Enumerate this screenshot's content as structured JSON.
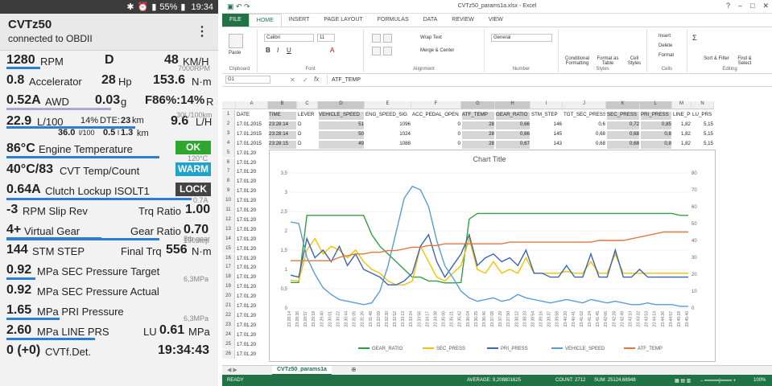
{
  "phone": {
    "status_bar": {
      "battery": "55%",
      "time": "19:34"
    },
    "app_title": "CVTz50",
    "app_subtitle": "connected to OBDII",
    "rows": {
      "r1": {
        "a": "1280",
        "b": "RPM",
        "c": "D",
        "d": "48",
        "e": "KM/H",
        "g": "7000RPM"
      },
      "r2": {
        "a": "0.8",
        "b": "Accelerator",
        "c": "28",
        "d": "Hp",
        "e": "153.6",
        "f": "N·m"
      },
      "r3": {
        "a": "0.52A",
        "b": "AWD",
        "c": "0.03",
        "d": "g",
        "e": "F86%:14%",
        "f": "R"
      },
      "r4": {
        "a": "22.9",
        "b": "L/100",
        "c": "14%",
        "d": "DTE:",
        "e": "23",
        "f": "km",
        "g": "9.6",
        "h": "L/H",
        "i": "30L/100km"
      },
      "r4b": {
        "a": "36.0",
        "b": "l/100",
        "c": "0.5",
        "d": "l",
        "e": "1.3",
        "f": "km"
      },
      "r5": {
        "a": "86°C",
        "b": "Engine Temperature",
        "c": "OK",
        "g": "120°C"
      },
      "r6": {
        "a": "40°C/83",
        "b": "CVT Temp/Count",
        "c": "WARM"
      },
      "r7": {
        "a": "0.64A",
        "b": "Clutch Lockup ISOLT1",
        "c": "LOCK",
        "g": "0.7A"
      },
      "r8": {
        "a": "-3",
        "b": "RPM Slip Rev",
        "c": "Trq Ratio",
        "d": "1.00"
      },
      "r9": {
        "a": "4+",
        "b": "Virtual Gear",
        "c": "Gear Ratio",
        "d": "0.70",
        "g": "8th gear"
      },
      "r10": {
        "a": "144",
        "b": "STM STEP",
        "c": "Final Trq",
        "d": "556",
        "e": "N·m",
        "g": "190step"
      },
      "r11": {
        "a": "0.92",
        "b": "MPa SEC Pressure Target",
        "g": "6,3MPa"
      },
      "r12": {
        "a": "0.92",
        "b": "MPa SEC Pressure Actual"
      },
      "r13": {
        "a": "1.65",
        "b": "MPa PRI Pressure",
        "g": "6,3MPa"
      },
      "r14": {
        "a": "2.60",
        "b": "MPa LINE PRS",
        "c": "LU",
        "d": "0.61",
        "e": "MPa"
      },
      "r15": {
        "a": "0 (+0)",
        "b": "CVTf.Det.",
        "c": "19:34:43"
      }
    },
    "colors": {
      "bar": "#2a7fd4",
      "ok": "#2fa62f",
      "warm": "#1fa3c9",
      "lock": "#444444"
    }
  },
  "excel": {
    "title": "CVTz50_params1a.xlsx - Excel",
    "tabs": [
      "FILE",
      "HOME",
      "INSERT",
      "PAGE LAYOUT",
      "FORMULAS",
      "DATA",
      "REVIEW",
      "VIEW"
    ],
    "ribbon": {
      "paste": "Paste",
      "font": "Calibri",
      "size": "11",
      "wrap": "Wrap Text",
      "merge": "Merge & Center",
      "numfmt": "General",
      "cond": "Conditional Formatting",
      "fmt_table": "Format as Table",
      "cell_styles": "Cell Styles",
      "insert": "Insert",
      "delete": "Delete",
      "format": "Format",
      "sort": "Sort & Filter",
      "find": "Find & Select",
      "groups": [
        "Clipboard",
        "Font",
        "Alignment",
        "Number",
        "Styles",
        "Cells",
        "Editing"
      ]
    },
    "name_box": "G1",
    "formula": "ATF_TEMP",
    "columns": [
      "A",
      "B",
      "C",
      "D",
      "E",
      "F",
      "G",
      "H",
      "I",
      "J",
      "K",
      "L",
      "M",
      "N"
    ],
    "header_row": [
      "DATE",
      "TIME",
      "LEVER",
      "VEHICLE_SPEED",
      "ENG_SPEED_SIG",
      "ACC_PEDAL_OPEN",
      "ATF_TEMP",
      "GEAR_RATIO",
      "STM_STEP",
      "TGT_SEC_PRESS",
      "SEC_PRESS",
      "PRI_PRESS",
      "LINE_PRS",
      "LU_PRS"
    ],
    "data_rows": [
      [
        "17.01.2015",
        "23:28:14",
        "D",
        "51",
        "1096",
        "0",
        "28",
        "0,66",
        "146",
        "0,6",
        "0,72",
        "0,85",
        "1,82",
        "5,15"
      ],
      [
        "17.01.2015",
        "23:28:14",
        "D",
        "50",
        "1024",
        "0",
        "28",
        "0,66",
        "145",
        "0,68",
        "0,68",
        "0,8",
        "1,82",
        "5,15"
      ],
      [
        "17.01.2015",
        "23:28:15",
        "D",
        "49",
        "1088",
        "0",
        "28",
        "0,67",
        "143",
        "0,68",
        "0,68",
        "0,8",
        "1,82",
        "5,15"
      ]
    ],
    "date_stub": "17.01.20",
    "col_m_values": [
      "1,9",
      "1,9",
      "1,88",
      "1,81",
      "1,8",
      "1,96",
      "1,65",
      "1,62",
      "1,59",
      "1,78",
      "2,1",
      "2,25",
      "3,25",
      "2,62",
      "2,5",
      "2,3",
      "2,27",
      "2,27",
      "2,37",
      "1,58",
      "2,4",
      "2,5"
    ],
    "col_n_values": [
      "5,15",
      "5,15",
      "5,15",
      "5,15",
      "5,15",
      "5,15",
      "5,15",
      "5,15",
      "5,15",
      "5,15",
      "5,15",
      "5,15",
      "5,15",
      "5,15",
      "5,15",
      "5,15",
      "5,15",
      "5,15",
      "5,15",
      "5,15",
      "5,15",
      "5,15"
    ],
    "row_numbers": [
      "1",
      "2",
      "3",
      "4",
      "5",
      "6",
      "7",
      "8",
      "9",
      "10",
      "11",
      "12",
      "13",
      "14",
      "15",
      "16",
      "17",
      "18",
      "19",
      "20",
      "21",
      "22",
      "23",
      "24",
      "25",
      "26"
    ],
    "sheet_tab": "CVTz50_params1a",
    "status": {
      "ready": "READY",
      "average": "AVERAGE: 9,208801625",
      "count": "COUNT: 2712",
      "sum": "SUM: 25124,68948",
      "zoom": "100%"
    }
  },
  "chart_data": {
    "type": "line",
    "title": "Chart Title",
    "y_left_ticks": [
      "0",
      "0,5",
      "1",
      "1,5",
      "2",
      "2,5",
      "3",
      "3,5"
    ],
    "y_right_ticks": [
      "0",
      "10",
      "20",
      "30",
      "40",
      "50",
      "60",
      "70",
      "80"
    ],
    "ylim_left": [
      0,
      3.5
    ],
    "ylim_right": [
      0,
      80
    ],
    "x_tick_labels": [
      "23:28:14",
      "23:28:36",
      "23:28:57",
      "23:29:18",
      "23:29:40",
      "23:30:01",
      "23:30:22",
      "23:30:44",
      "23:31:05",
      "23:31:26",
      "23:31:48",
      "23:32:09",
      "23:32:30",
      "23:32:52",
      "23:33:13",
      "23:33:34",
      "23:33:56",
      "23:34:17",
      "23:34:38",
      "23:35:00",
      "23:35:21",
      "23:35:42",
      "23:36:04",
      "23:36:25",
      "23:36:46",
      "23:37:08",
      "23:37:29",
      "23:37:50",
      "23:38:12",
      "23:38:33",
      "23:38:54",
      "23:39:16",
      "23:39:37",
      "23:39:58",
      "23:40:20",
      "23:40:41",
      "23:41:02",
      "23:41:24",
      "23:41:45",
      "23:42:06",
      "23:42:28",
      "23:42:49",
      "23:43:10",
      "23:43:32",
      "23:43:53",
      "23:44:14",
      "23:44:36",
      "23:44:57",
      "23:45:18",
      "23:45:40"
    ],
    "series": [
      {
        "name": "GEAR_RATIO",
        "color": "#2ea043",
        "axis": "left",
        "values": [
          0.66,
          0.66,
          2.4,
          2.4,
          2.4,
          2.4,
          2.4,
          2.4,
          2.4,
          2.4,
          1.9,
          1.6,
          1.4,
          1.2,
          1.0,
          0.8,
          0.8,
          0.7,
          0.7,
          0.65,
          0.65,
          0.66,
          2.3,
          2.45,
          2.45,
          2.45,
          2.45,
          2.45,
          2.45,
          2.45,
          2.45,
          2.45,
          2.45,
          2.45,
          2.45,
          2.45,
          2.45,
          2.45,
          2.45,
          2.45,
          2.45,
          2.45,
          2.45,
          2.45,
          2.45,
          2.45,
          2.45,
          2.45,
          2.4,
          2.4
        ]
      },
      {
        "name": "SEC_PRESS",
        "color": "#f2c200",
        "axis": "left",
        "values": [
          0.72,
          0.7,
          1.5,
          1.8,
          1.4,
          1.6,
          1.5,
          1.3,
          1.5,
          1.2,
          1.0,
          0.9,
          0.7,
          0.6,
          0.6,
          0.7,
          1.6,
          1.2,
          0.8,
          0.7,
          0.9,
          1.1,
          1.8,
          1.0,
          0.9,
          1.2,
          0.9,
          1.0,
          0.9,
          1.3,
          0.9,
          0.9,
          0.9,
          0.9,
          0.95,
          0.9,
          0.9,
          1.2,
          0.9,
          0.9,
          1.4,
          0.9,
          0.9,
          0.9,
          0.9,
          0.9,
          0.9,
          0.9,
          0.9,
          0.9
        ]
      },
      {
        "name": "PRI_PRESS",
        "color": "#3b64b5",
        "axis": "left",
        "values": [
          0.85,
          0.8,
          1.8,
          1.3,
          1.5,
          1.2,
          1.6,
          1.1,
          1.4,
          1.0,
          0.9,
          0.8,
          0.6,
          0.6,
          0.7,
          0.9,
          1.6,
          1.9,
          1.2,
          0.8,
          1.1,
          1.4,
          1.9,
          1.1,
          1.3,
          1.4,
          1.2,
          1.3,
          1.1,
          1.5,
          0.9,
          0.9,
          0.8,
          0.8,
          1.1,
          0.8,
          0.8,
          1.4,
          0.8,
          0.8,
          1.5,
          0.8,
          0.8,
          1.0,
          0.8,
          0.8,
          0.8,
          0.8,
          0.8,
          0.8
        ]
      },
      {
        "name": "VEHICLE_SPEED",
        "color": "#5b9bd5",
        "axis": "right",
        "values": [
          51,
          50,
          30,
          20,
          12,
          8,
          5,
          4,
          3,
          2,
          3,
          10,
          25,
          45,
          65,
          72,
          70,
          60,
          40,
          25,
          18,
          10,
          6,
          4,
          5,
          6,
          4,
          5,
          8,
          6,
          5,
          4,
          3,
          4,
          5,
          4,
          3,
          5,
          4,
          3,
          4,
          3,
          2,
          2,
          3,
          2,
          2,
          2,
          1,
          1
        ]
      },
      {
        "name": "ATF_TEMP",
        "color": "#e2773a",
        "axis": "right",
        "values": [
          28,
          28,
          28,
          28,
          28,
          28,
          30,
          31,
          32,
          32,
          33,
          33,
          34,
          34,
          35,
          36,
          36,
          37,
          37,
          38,
          38,
          38,
          38,
          38,
          38,
          38,
          38,
          39,
          39,
          39,
          39,
          39,
          39,
          39,
          39,
          39,
          39,
          39,
          40,
          40,
          40,
          40,
          41,
          42,
          43,
          44,
          45,
          45,
          45,
          45
        ]
      }
    ]
  }
}
